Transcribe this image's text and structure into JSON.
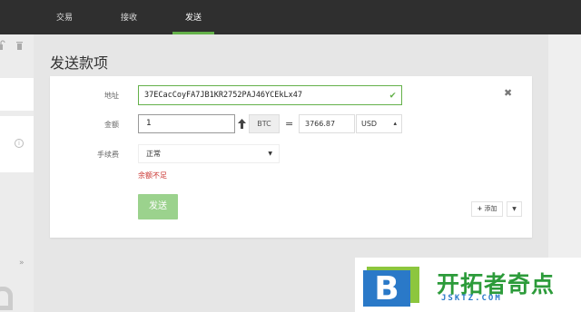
{
  "nav": {
    "tabs": [
      {
        "label": "交易"
      },
      {
        "label": "接收"
      },
      {
        "label": "发送"
      }
    ],
    "active_tab": "发送"
  },
  "sidebar": {
    "icons": [
      "unlock-icon",
      "trash-icon",
      "info-icon",
      "collapse-icon",
      "lock-icon"
    ],
    "collapse_glyph": "»"
  },
  "send_form": {
    "title": "发送款项",
    "address_label": "地址",
    "address_value": "37ECacCoyFA7JB1KR2752PAJ46YCEkLx47",
    "amount_label": "金额",
    "amount_value": "1",
    "btc_unit": "BTC",
    "equals_sign": "=",
    "fiat_value": "3766.87",
    "fiat_currency": "USD",
    "fee_label": "手续费",
    "fee_value": "正常",
    "error_message": "余额不足",
    "send_button": "发送",
    "add_button": "添加"
  },
  "watermark": {
    "letter": "B",
    "title": "开拓者奇点",
    "url": "JSKTZ.COM"
  },
  "colors": {
    "nav_bg": "#2f2f2f",
    "accent_green": "#64b14a",
    "send_button_disabled": "#9bd28d",
    "error_red": "#c9302c"
  }
}
